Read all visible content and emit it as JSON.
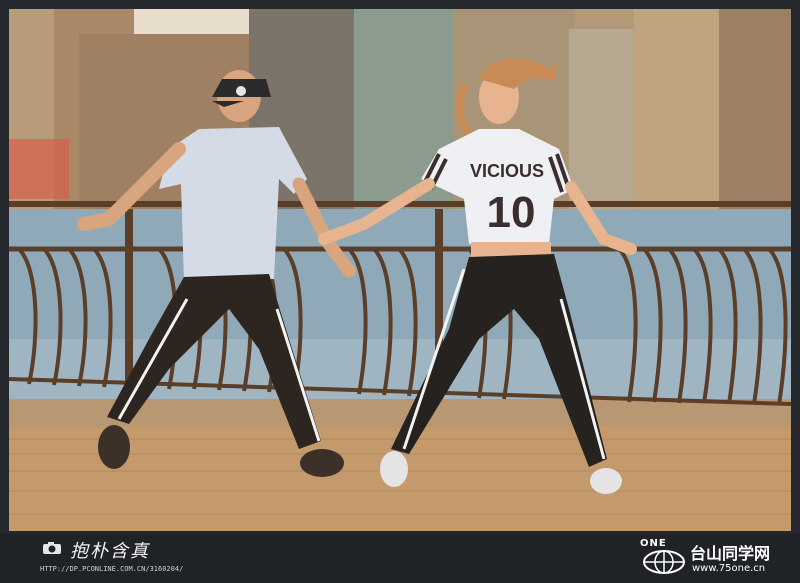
{
  "photo": {
    "jersey_text": "VICIOUS",
    "jersey_number": "10"
  },
  "watermark_left": {
    "title": "抱朴含真",
    "url": "HTTP://DP.PCONLINE.COM.CN/3160204/"
  },
  "watermark_right": {
    "brand": "ONE",
    "site_name": "台山同学网",
    "site_url": "www.75one.cn"
  },
  "colors": {
    "frame": "#25292d",
    "deck": "#c49a6c",
    "railing": "#5a3e28",
    "water": "#8fa9b8"
  }
}
